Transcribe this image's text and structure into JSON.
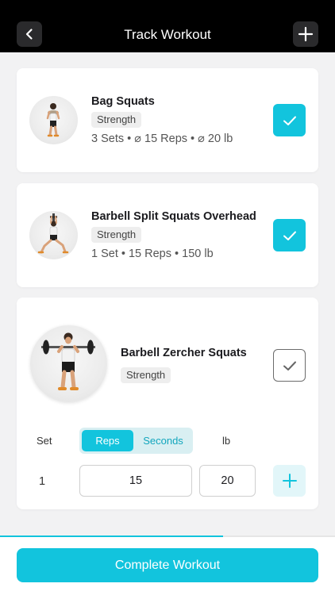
{
  "header": {
    "title": "Track Workout",
    "back_icon": "chevron-left-icon",
    "add_icon": "plus-icon"
  },
  "exercises": [
    {
      "name": "Bag Squats",
      "category": "Strength",
      "summary": "3 Sets • ⌀ 15 Reps • ⌀ 20 lb",
      "completed": true
    },
    {
      "name": "Barbell Split Squats Overhead",
      "category": "Strength",
      "summary": "1 Set • 15 Reps • 150 lb",
      "completed": true
    },
    {
      "name": "Barbell Zercher Squats",
      "category": "Strength",
      "completed": false,
      "set_editor": {
        "set_label": "Set",
        "reps_option": "Reps",
        "seconds_option": "Seconds",
        "selected_option": "Reps",
        "weight_label": "lb",
        "sets": [
          {
            "set_number": "1",
            "reps": "15",
            "weight": "20"
          }
        ]
      }
    }
  ],
  "progress_fraction": 0.665,
  "complete_button": "Complete Workout",
  "colors": {
    "accent": "#12c4dd",
    "accent_light": "#e2f6f9",
    "header_bg": "#000000"
  }
}
